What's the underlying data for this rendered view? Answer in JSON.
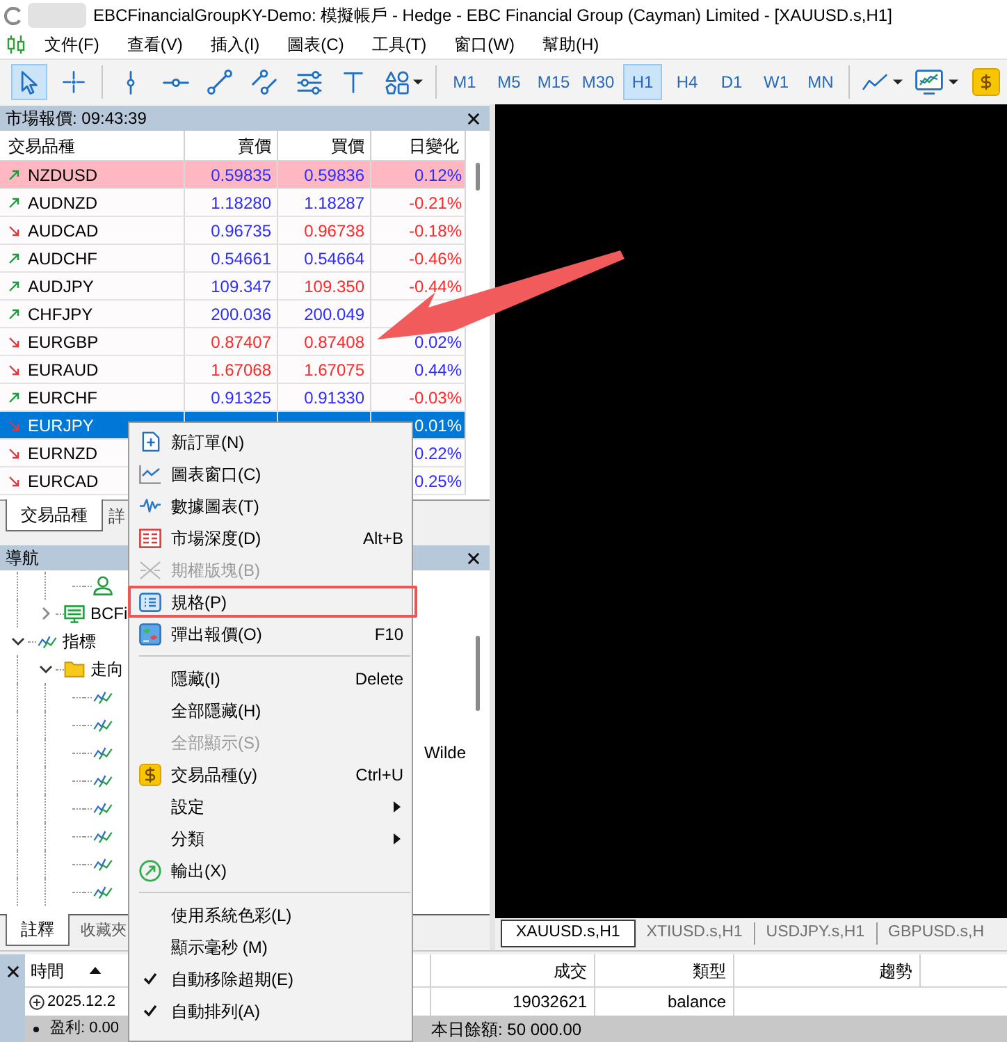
{
  "window": {
    "title": "EBCFinancialGroupKY-Demo: 模擬帳戶 - Hedge - EBC Financial Group (Cayman) Limited - [XAUUSD.s,H1]"
  },
  "menu_bar": [
    "文件(F)",
    "查看(V)",
    "插入(I)",
    "圖表(C)",
    "工具(T)",
    "窗口(W)",
    "幫助(H)"
  ],
  "toolbar": {
    "tool_groups": [
      [
        {
          "kind": "cursor",
          "selected": true
        },
        {
          "kind": "crosshair",
          "selected": false
        }
      ],
      [
        {
          "kind": "vertical-line",
          "selected": false
        },
        {
          "kind": "horizontal-line",
          "selected": false
        },
        {
          "kind": "trend-line",
          "selected": false
        },
        {
          "kind": "channel",
          "selected": false
        },
        {
          "kind": "levels",
          "selected": false
        },
        {
          "kind": "text",
          "selected": false
        },
        {
          "kind": "shapes",
          "selected": false
        }
      ]
    ],
    "timeframes": [
      {
        "label": "M1",
        "selected": false
      },
      {
        "label": "M5",
        "selected": false
      },
      {
        "label": "M15",
        "selected": false
      },
      {
        "label": "M30",
        "selected": false
      },
      {
        "label": "H1",
        "selected": true
      },
      {
        "label": "H4",
        "selected": false
      },
      {
        "label": "D1",
        "selected": false
      },
      {
        "label": "W1",
        "selected": false
      },
      {
        "label": "MN",
        "selected": false
      }
    ],
    "chart_tools": [
      {
        "kind": "chart-type"
      },
      {
        "kind": "indicators"
      },
      {
        "kind": "symbols"
      }
    ]
  },
  "market_watch": {
    "title": "市場報價: 09:43:39",
    "columns": [
      "交易品種",
      "賣價",
      "買價",
      "日變化"
    ],
    "rows": [
      {
        "symbol": "NZDUSD",
        "rising": true,
        "highlighted": true,
        "selected": false,
        "bid": {
          "value": "0.59835",
          "rising": true
        },
        "ask": {
          "value": "0.59836",
          "rising": true
        },
        "change": {
          "value": "0.12%",
          "rising": true
        }
      },
      {
        "symbol": "AUDNZD",
        "rising": true,
        "highlighted": false,
        "selected": false,
        "bid": {
          "value": "1.18280",
          "rising": true
        },
        "ask": {
          "value": "1.18287",
          "rising": true
        },
        "change": {
          "value": "-0.21%",
          "rising": false
        }
      },
      {
        "symbol": "AUDCAD",
        "rising": false,
        "highlighted": false,
        "selected": false,
        "bid": {
          "value": "0.96735",
          "rising": true
        },
        "ask": {
          "value": "0.96738",
          "rising": false
        },
        "change": {
          "value": "-0.18%",
          "rising": false
        }
      },
      {
        "symbol": "AUDCHF",
        "rising": true,
        "highlighted": false,
        "selected": false,
        "bid": {
          "value": "0.54661",
          "rising": true
        },
        "ask": {
          "value": "0.54664",
          "rising": true
        },
        "change": {
          "value": "-0.46%",
          "rising": false
        }
      },
      {
        "symbol": "AUDJPY",
        "rising": true,
        "highlighted": false,
        "selected": false,
        "bid": {
          "value": "109.347",
          "rising": true
        },
        "ask": {
          "value": "109.350",
          "rising": false
        },
        "change": {
          "value": "-0.44%",
          "rising": false
        }
      },
      {
        "symbol": "CHFJPY",
        "rising": true,
        "highlighted": false,
        "selected": false,
        "bid": {
          "value": "200.036",
          "rising": true
        },
        "ask": {
          "value": "200.049",
          "rising": true
        }
      },
      {
        "symbol": "EURGBP",
        "rising": false,
        "highlighted": false,
        "selected": false,
        "bid": {
          "value": "0.87407",
          "rising": false
        },
        "ask": {
          "value": "0.87408",
          "rising": false
        },
        "change": {
          "value": "0.02%",
          "rising": true
        }
      },
      {
        "symbol": "EURAUD",
        "rising": false,
        "highlighted": false,
        "selected": false,
        "bid": {
          "value": "1.67068",
          "rising": false
        },
        "ask": {
          "value": "1.67075",
          "rising": false
        },
        "change": {
          "value": "0.44%",
          "rising": true
        }
      },
      {
        "symbol": "EURCHF",
        "rising": true,
        "highlighted": false,
        "selected": false,
        "bid": {
          "value": "0.91325",
          "rising": true
        },
        "ask": {
          "value": "0.91330",
          "rising": true
        },
        "change": {
          "value": "-0.03%",
          "rising": false
        }
      },
      {
        "symbol": "EURJPY",
        "rising": false,
        "highlighted": false,
        "selected": true,
        "change": {
          "value": "0.01%"
        }
      },
      {
        "symbol": "EURNZD",
        "rising": false,
        "highlighted": false,
        "selected": false,
        "change": {
          "value": "0.22%",
          "rising": true
        }
      },
      {
        "symbol": "EURCAD",
        "rising": false,
        "highlighted": false,
        "selected": false,
        "change": {
          "value": "0.25%",
          "rising": true
        }
      }
    ],
    "tabs": [
      {
        "label": "交易品種",
        "selected": true
      },
      {
        "label": "詳",
        "selected": false
      }
    ]
  },
  "navigator": {
    "title": "導航",
    "tree": [
      {
        "children": [
          {
            "children": [
              {
                "kind": "account"
              }
            ]
          },
          {
            "kind": "server",
            "label": "BCFi",
            "expanded": false
          }
        ]
      },
      {
        "kind": "indicators",
        "label": "指標",
        "expanded": true,
        "children": [
          {
            "kind": "folder",
            "label": "走向",
            "expanded": true,
            "children": [
              {
                "kind": "indicator"
              },
              {
                "kind": "indicator"
              },
              {
                "kind": "indicator",
                "label_end": "Wilde"
              },
              {
                "kind": "indicator"
              },
              {
                "kind": "indicator"
              },
              {
                "kind": "indicator"
              },
              {
                "kind": "indicator"
              },
              {
                "kind": "indicator"
              }
            ]
          }
        ]
      }
    ],
    "tabs": [
      {
        "label": "註釋",
        "selected": true
      },
      {
        "label": "收藏夾",
        "selected": false
      }
    ]
  },
  "chart_tabs": [
    {
      "label": "XAUUSD.s,H1",
      "selected": true
    },
    {
      "label": "XTIUSD.s,H1",
      "selected": false
    },
    {
      "label": "USDJPY.s,H1",
      "selected": false
    },
    {
      "label": "GBPUSD.s,H",
      "selected": false
    }
  ],
  "terminal": {
    "columns": [
      {
        "label": "時間",
        "sorted": true
      },
      {
        "label": "成交",
        "sorted": false
      },
      {
        "label": "類型",
        "sorted": false
      },
      {
        "label": "趨勢",
        "sorted": false
      }
    ],
    "rows": [
      {
        "expanded": false,
        "cells": [
          "2025.12.2",
          "19032621",
          "balance"
        ]
      }
    ],
    "status": {
      "profit": "盈利: 0.00",
      "balance": "本日餘額: 50 000.00"
    }
  },
  "context_menu": {
    "items": [
      {
        "kind": "item",
        "label": "新訂單(N)",
        "disabled": false,
        "checked": false,
        "submenu": false,
        "annotated": false
      },
      {
        "kind": "item",
        "label": "圖表窗口(C)",
        "disabled": false,
        "checked": false,
        "submenu": false,
        "annotated": false
      },
      {
        "kind": "item",
        "label": "數據圖表(T)",
        "disabled": false,
        "checked": false,
        "submenu": false,
        "annotated": false
      },
      {
        "kind": "item",
        "label": "市場深度(D)",
        "shortcut": "Alt+B",
        "disabled": false,
        "checked": false,
        "submenu": false,
        "annotated": false
      },
      {
        "kind": "item",
        "label": "期權版塊(B)",
        "disabled": true,
        "checked": false,
        "submenu": false,
        "annotated": false
      },
      {
        "kind": "item",
        "label": "規格(P)",
        "disabled": false,
        "checked": false,
        "submenu": false,
        "annotated": true
      },
      {
        "kind": "item",
        "label": "彈出報價(O)",
        "shortcut": "F10",
        "disabled": false,
        "checked": false,
        "submenu": false,
        "annotated": false
      },
      {
        "kind": "separator"
      },
      {
        "kind": "item",
        "label": "隱藏(I)",
        "shortcut": "Delete",
        "disabled": false,
        "checked": false,
        "submenu": false,
        "annotated": false
      },
      {
        "kind": "item",
        "label": "全部隱藏(H)",
        "disabled": false,
        "checked": false,
        "submenu": false,
        "annotated": false
      },
      {
        "kind": "item",
        "label": "全部顯示(S)",
        "disabled": true,
        "checked": false,
        "submenu": false,
        "annotated": false
      },
      {
        "kind": "item",
        "label": "交易品種(y)",
        "shortcut": "Ctrl+U",
        "disabled": false,
        "checked": false,
        "submenu": false,
        "annotated": false
      },
      {
        "kind": "item",
        "label": "設定",
        "disabled": false,
        "checked": false,
        "submenu": true,
        "annotated": false
      },
      {
        "kind": "item",
        "label": "分類",
        "disabled": false,
        "checked": false,
        "submenu": true,
        "annotated": false
      },
      {
        "kind": "item",
        "label": "輸出(X)",
        "disabled": false,
        "checked": false,
        "submenu": false,
        "annotated": false
      },
      {
        "kind": "separator"
      },
      {
        "kind": "item",
        "label": "使用系統色彩(L)",
        "disabled": false,
        "checked": false,
        "submenu": false,
        "annotated": false
      },
      {
        "kind": "item",
        "label": "顯示毫秒 (M)",
        "disabled": false,
        "checked": false,
        "submenu": false,
        "annotated": false
      },
      {
        "kind": "item",
        "label": "自動移除超期(E)",
        "disabled": false,
        "checked": true,
        "submenu": false,
        "annotated": false
      },
      {
        "kind": "item",
        "label": "自動排列(A)",
        "disabled": false,
        "checked": true,
        "submenu": false,
        "annotated": false
      }
    ]
  },
  "annotations": [
    {
      "kind": "arrow"
    }
  ]
}
